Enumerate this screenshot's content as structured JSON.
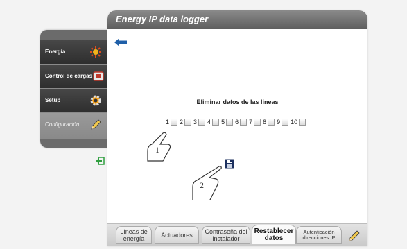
{
  "window": {
    "title": "Energy IP data logger"
  },
  "menu": {
    "items": [
      {
        "label": "Energía",
        "icon": "energy-icon"
      },
      {
        "label": "Control de cargas",
        "icon": "loads-icon"
      },
      {
        "label": "Setup",
        "icon": "gear-icon"
      },
      {
        "label": "Configuración",
        "icon": "pencil-icon",
        "active": true
      }
    ]
  },
  "content": {
    "heading": "Eliminar datos de las lineas",
    "lines": [
      "1",
      "2",
      "3",
      "4",
      "5",
      "6",
      "7",
      "8",
      "9",
      "10"
    ]
  },
  "tabs": [
    {
      "label": "Líneas de energía"
    },
    {
      "label": "Actuadores"
    },
    {
      "label": "Contraseña del instalador"
    },
    {
      "label": "Restablecer datos",
      "active": true
    },
    {
      "label": "Autenticación direcciones IP"
    }
  ],
  "callouts": {
    "one": "1",
    "two": "2"
  },
  "colors": {
    "accent": "#1f5fa8",
    "titlebar": "#6d6d6d",
    "menu_dark": "#3a3a3a"
  }
}
